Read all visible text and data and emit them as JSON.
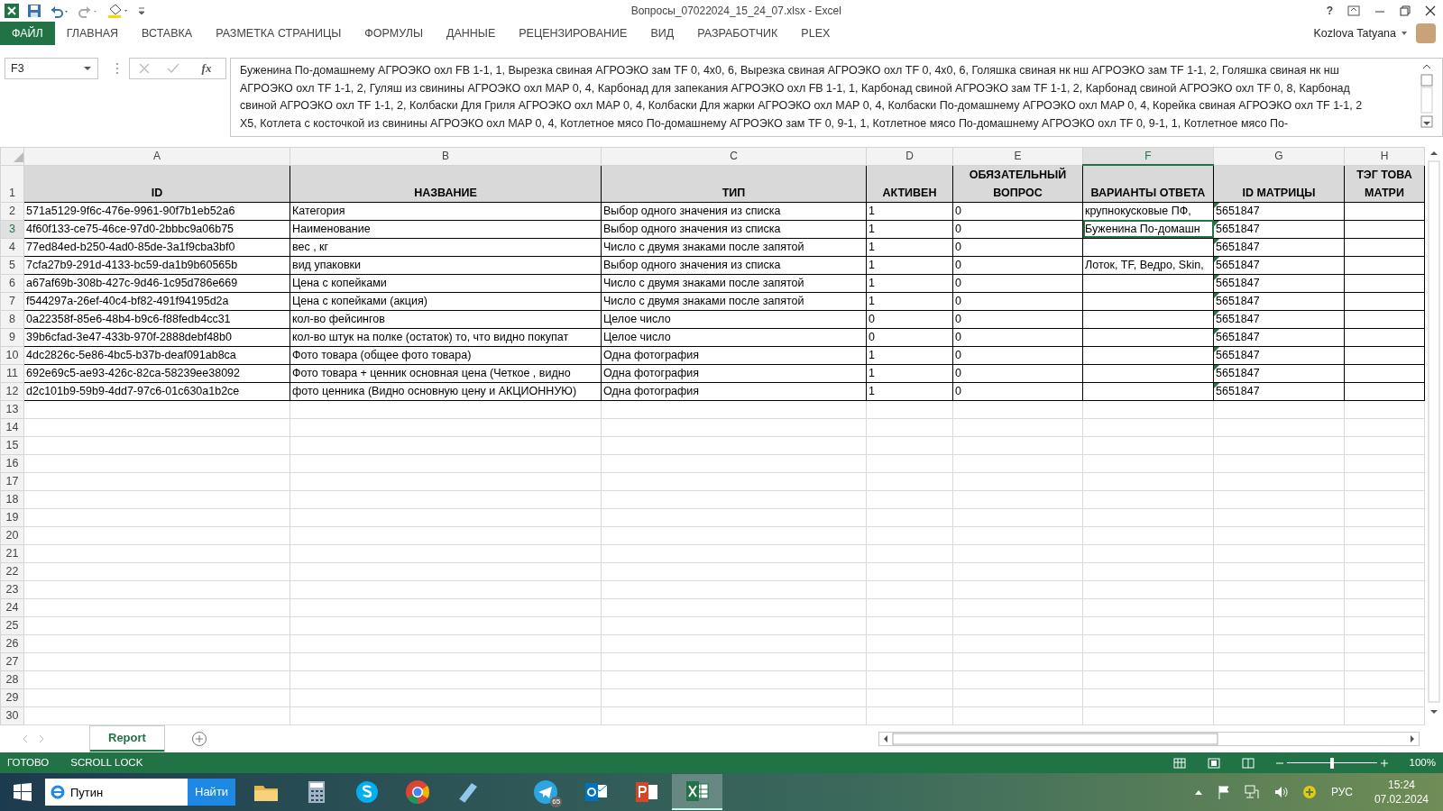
{
  "window": {
    "title": "Вопросы_07022024_15_24_07.xlsx - Excel",
    "help": "?"
  },
  "ribbon_tabs": [
    {
      "label": "ФАЙЛ",
      "kind": "file",
      "selected": false
    },
    {
      "label": "ГЛАВНАЯ",
      "kind": "tab",
      "selected": false
    },
    {
      "label": "ВСТАВКА",
      "kind": "tab",
      "selected": false
    },
    {
      "label": "РАЗМЕТКА СТРАНИЦЫ",
      "kind": "tab",
      "selected": false
    },
    {
      "label": "ФОРМУЛЫ",
      "kind": "tab",
      "selected": false
    },
    {
      "label": "ДАННЫЕ",
      "kind": "tab",
      "selected": false
    },
    {
      "label": "РЕЦЕНЗИРОВАНИЕ",
      "kind": "tab",
      "selected": false
    },
    {
      "label": "ВИД",
      "kind": "tab",
      "selected": false
    },
    {
      "label": "РАЗРАБОТЧИК",
      "kind": "tab",
      "selected": false
    },
    {
      "label": "PLEX",
      "kind": "tab",
      "selected": false
    }
  ],
  "user": {
    "name": "Kozlova Tatyana"
  },
  "formula_bar": {
    "name_box": "F3",
    "fx": "fx",
    "lines": [
      "Буженина По-домашнему АГРОЭКО охл FB 1-1, 1, Вырезка свиная АГРОЭКО зам TF 0, 4x0, 6, Вырезка свиная АГРОЭКО охл TF 0, 4x0, 6, Голяшка свиная нк нш АГРОЭКО зам TF 1-1, 2, Голяшка свиная нк нш",
      "АГРОЭКО охл TF 1-1, 2, Гуляш из свинины АГРОЭКО охл MAP 0, 4, Карбонад для запекания АГРОЭКО охл FB 1-1, 1, Карбонад свиной АГРОЭКО зам TF 1-1, 2, Карбонад свиной АГРОЭКО охл TF 0, 8, Карбонад",
      "свиной АГРОЭКО охл TF 1-1, 2, Колбаски Для Гриля АГРОЭКО охл MAP 0, 4, Колбаски Для жарки АГРОЭКО охл MAP 0, 4, Колбаски По-домашнему АГРОЭКО охл MAP 0, 4, Корейка свиная АГРОЭКО охл TF 1-1, 2",
      "X5, Котлета с косточкой из свинины АГРОЭКО охл MAP 0, 4, Котлетное мясо По-домашнему АГРОЭКО зам TF 0, 9-1, 1, Котлетное мясо По-домашнему АГРОЭКО охл TF 0, 9-1, 1, Котлетное мясо По-"
    ]
  },
  "columns": [
    {
      "letter": "A",
      "selected": false,
      "flagged": false
    },
    {
      "letter": "B",
      "selected": false,
      "flagged": false
    },
    {
      "letter": "C",
      "selected": false,
      "flagged": false
    },
    {
      "letter": "D",
      "selected": false,
      "flagged": false
    },
    {
      "letter": "E",
      "selected": false,
      "flagged": false
    },
    {
      "letter": "F",
      "selected": true,
      "flagged": false
    },
    {
      "letter": "G",
      "selected": false,
      "flagged": true
    },
    {
      "letter": "H",
      "selected": false,
      "flagged": false
    }
  ],
  "rows": [
    {
      "number": "1",
      "kind": "header",
      "selected": false,
      "cells": [
        "ID",
        "НАЗВАНИЕ",
        "ТИП",
        "АКТИВЕН",
        "ОБЯЗАТЕЛЬНЫЙ ВОПРОС",
        "ВАРИАНТЫ ОТВЕТА",
        "ID МАТРИЦЫ",
        "ТЭГ ТОВА МАТРИ"
      ]
    },
    {
      "number": "2",
      "kind": "data",
      "selected": false,
      "cells": [
        "571a5129-9f6c-476e-9961-90f7b1eb52a6",
        "Категория",
        "Выбор одного значения из списка",
        "1",
        "0",
        "крупнокусковые ПФ,",
        "5651847",
        null
      ]
    },
    {
      "number": "3",
      "kind": "data",
      "selected": true,
      "cells": [
        "4f60f133-ce75-46ce-97d0-2bbbc9a06b75",
        "Наименование",
        "Выбор одного значения из списка",
        "1",
        "0",
        "Буженина По-домашн",
        "5651847",
        null
      ]
    },
    {
      "number": "4",
      "kind": "data",
      "selected": false,
      "cells": [
        "77ed84ed-b250-4ad0-85de-3a1f9cba3bf0",
        "вес , кг",
        "Число с двумя знаками после запятой",
        "1",
        "0",
        null,
        "5651847",
        null
      ]
    },
    {
      "number": "5",
      "kind": "data",
      "selected": false,
      "cells": [
        "7cfa27b9-291d-4133-bc59-da1b9b60565b",
        "вид упаковки",
        "Выбор одного значения из списка",
        "1",
        "0",
        "Лоток, TF, Ведро, Skin,",
        "5651847",
        null
      ]
    },
    {
      "number": "6",
      "kind": "data",
      "selected": false,
      "cells": [
        "a67af69b-308b-427c-9d46-1c95d786e669",
        "Цена с копейками",
        "Число с двумя знаками после запятой",
        "1",
        "0",
        null,
        "5651847",
        null
      ]
    },
    {
      "number": "7",
      "kind": "data",
      "selected": false,
      "cells": [
        "f544297a-26ef-40c4-bf82-491f94195d2a",
        "Цена с копейками (акция)",
        "Число с двумя знаками после запятой",
        "1",
        "0",
        null,
        "5651847",
        null
      ]
    },
    {
      "number": "8",
      "kind": "data",
      "selected": false,
      "cells": [
        "0a22358f-85e6-48b4-b9c6-f88fedb4cc31",
        "кол-во фейсингов",
        "Целое число",
        "0",
        "0",
        null,
        "5651847",
        null
      ]
    },
    {
      "number": "9",
      "kind": "data",
      "selected": false,
      "cells": [
        "39b6cfad-3e47-433b-970f-2888debf48b0",
        "кол-во штук на полке (остаток) то, что видно покупат",
        "Целое число",
        "0",
        "0",
        null,
        "5651847",
        null
      ]
    },
    {
      "number": "10",
      "kind": "data",
      "selected": false,
      "cells": [
        "4dc2826c-5e86-4bc5-b37b-deaf091ab8ca",
        "Фото товара (общее фото товара)",
        "Одна фотография",
        "1",
        "0",
        null,
        "5651847",
        null
      ]
    },
    {
      "number": "11",
      "kind": "data",
      "selected": false,
      "cells": [
        "692e69c5-ae93-426c-82ca-58239ee38092",
        "Фото товара + ценник основная цена (Четкое , видно",
        "Одна фотография",
        "1",
        "0",
        null,
        "5651847",
        null
      ]
    },
    {
      "number": "12",
      "kind": "data",
      "selected": false,
      "cells": [
        "d2c101b9-59b9-4dd7-97c6-01c630a1b2ce",
        "фото ценника (Видно основную цену и АКЦИОННУЮ)",
        "Одна фотография",
        "1",
        "0",
        null,
        "5651847",
        null
      ]
    },
    {
      "number": "13",
      "kind": "empty",
      "selected": false
    },
    {
      "number": "14",
      "kind": "empty",
      "selected": false
    },
    {
      "number": "15",
      "kind": "empty",
      "selected": false
    },
    {
      "number": "16",
      "kind": "empty",
      "selected": false
    },
    {
      "number": "17",
      "kind": "empty",
      "selected": false
    },
    {
      "number": "18",
      "kind": "empty",
      "selected": false
    },
    {
      "number": "19",
      "kind": "empty",
      "selected": false
    },
    {
      "number": "20",
      "kind": "empty",
      "selected": false
    },
    {
      "number": "21",
      "kind": "empty",
      "selected": false
    },
    {
      "number": "22",
      "kind": "empty",
      "selected": false
    },
    {
      "number": "23",
      "kind": "empty",
      "selected": false
    },
    {
      "number": "24",
      "kind": "empty",
      "selected": false
    },
    {
      "number": "25",
      "kind": "empty",
      "selected": false
    },
    {
      "number": "26",
      "kind": "empty",
      "selected": false
    },
    {
      "number": "27",
      "kind": "empty",
      "selected": false
    },
    {
      "number": "28",
      "kind": "empty",
      "selected": false
    },
    {
      "number": "29",
      "kind": "empty",
      "selected": false
    },
    {
      "number": "30",
      "kind": "empty",
      "selected": false
    }
  ],
  "sheet_tabs": [
    {
      "label": "Report",
      "selected": true
    }
  ],
  "status_bar": {
    "items": [
      "ГОТОВО",
      "SCROLL LOCK"
    ],
    "zoom": "100%",
    "zoom_slider": {
      "level": 0.5
    }
  },
  "taskbar": {
    "search": {
      "value": "Путин",
      "button": "Найти"
    },
    "apps": [
      {
        "kind": "folder",
        "active": false
      },
      {
        "kind": "calculator",
        "active": false
      },
      {
        "kind": "chat",
        "active": false
      },
      {
        "kind": "browser",
        "active": false
      },
      {
        "kind": "notepad",
        "active": false
      },
      {
        "kind": "plane",
        "active": false,
        "badge": "65"
      },
      {
        "kind": "mail",
        "active": false
      },
      {
        "kind": "slides",
        "active": false
      },
      {
        "kind": "sheet",
        "active": true
      }
    ],
    "language": "РУС",
    "time": "15:24",
    "date": "07.02.2024"
  }
}
